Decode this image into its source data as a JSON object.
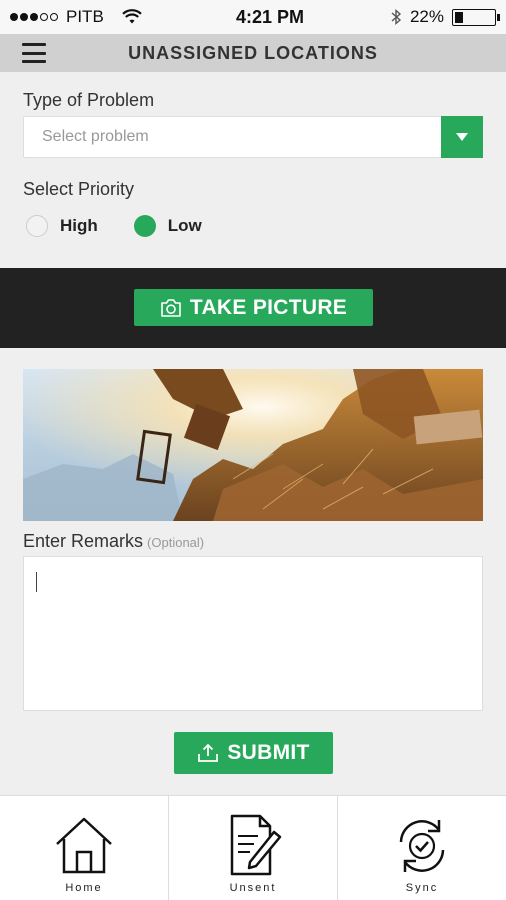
{
  "status_bar": {
    "carrier": "PITB",
    "time": "4:21 PM",
    "battery": "22%",
    "battery_level": 0.22
  },
  "header": {
    "title": "UNASSIGNED LOCATIONS",
    "menu_icon": "hamburger-menu-icon"
  },
  "form": {
    "problem_label": "Type of Problem",
    "problem_placeholder": "Select problem",
    "priority_label": "Select Priority",
    "priority_options": [
      {
        "label": "High",
        "selected": false
      },
      {
        "label": "Low",
        "selected": true
      }
    ],
    "take_picture_label": "TAKE PICTURE",
    "remarks_label": "Enter Remarks",
    "remarks_optional": "(Optional)",
    "remarks_value": "",
    "submit_label": "SUBMIT"
  },
  "bottom_nav": {
    "items": [
      {
        "label": "Home",
        "icon": "home-icon"
      },
      {
        "label": "Unsent",
        "icon": "document-edit-icon"
      },
      {
        "label": "Sync",
        "icon": "sync-check-icon"
      }
    ]
  },
  "colors": {
    "accent": "#27a85a",
    "header_bg": "#d0d0d0",
    "camera_band": "#222222"
  }
}
